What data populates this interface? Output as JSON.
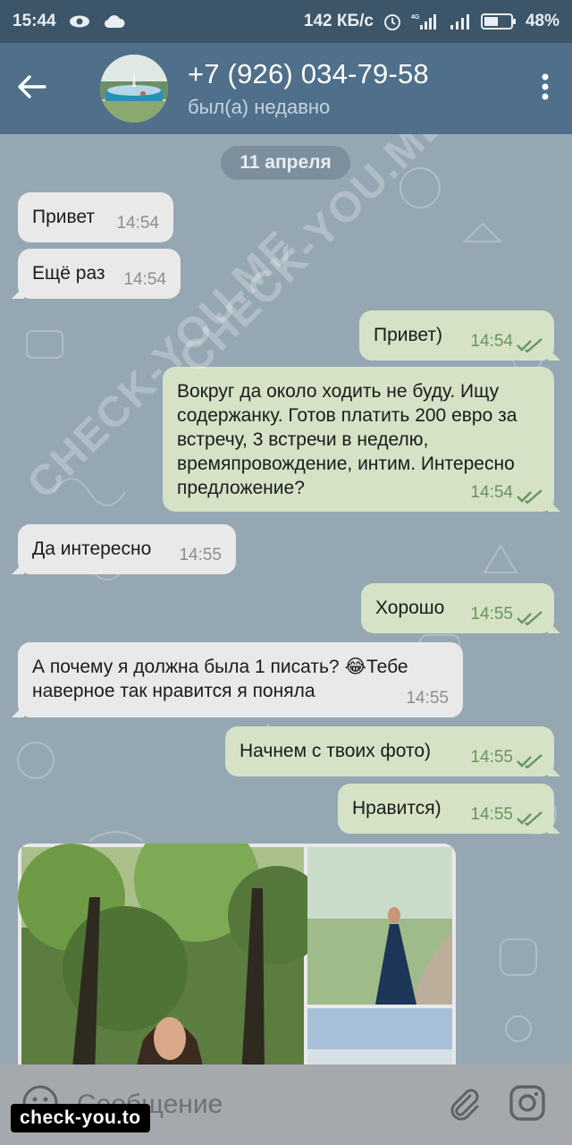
{
  "status_bar": {
    "time": "15:44",
    "net_speed": "142 КБ/с",
    "battery": "48%",
    "icons": [
      "eye-icon",
      "cloud-icon",
      "alarm-icon",
      "signal-icon",
      "signal-icon-2",
      "battery-icon"
    ]
  },
  "header": {
    "contact_name": "+7 (926) 034-79-58",
    "contact_status": "был(а) недавно",
    "back_icon": "arrow-left-icon",
    "menu_icon": "more-vertical-icon"
  },
  "chat": {
    "date_chip": "11 апреля",
    "messages": [
      {
        "dir": "in",
        "text": "Привет",
        "time": "14:54"
      },
      {
        "dir": "in",
        "text": "Ещё раз",
        "time": "14:54"
      },
      {
        "dir": "out",
        "text": "Привет)",
        "time": "14:54",
        "status": "read"
      },
      {
        "dir": "out",
        "text": "Вокруг да около ходить не буду. Ищу содержанку. Готов платить 200 евро за встречу, 3 встречи в неделю, времяпровождение, интим. Интересно предложение?",
        "time": "14:54",
        "status": "read"
      },
      {
        "dir": "in",
        "text": "Да интересно",
        "time": "14:55"
      },
      {
        "dir": "out",
        "text": "Хорошо",
        "time": "14:55",
        "status": "read"
      },
      {
        "dir": "in",
        "text": "А почему я должна была 1 писать? 😂Тебе наверное так нравится я поняла",
        "time": "14:55"
      },
      {
        "dir": "out",
        "text": "Начнем с твоих фото)",
        "time": "14:55",
        "status": "read"
      },
      {
        "dir": "out",
        "text": "Нравится)",
        "time": "14:55",
        "status": "read"
      }
    ],
    "photo_album": {
      "count_visible": 3
    }
  },
  "input_bar": {
    "placeholder": "Сообщение",
    "emoji_icon": "emoji-icon",
    "attach_icon": "paperclip-icon",
    "camera_icon": "instagram-camera-icon"
  },
  "watermarks": {
    "text": "CHECK-YOU.ME",
    "badge": "check-you.to"
  },
  "colors": {
    "header": "#4f6f8a",
    "statusbar": "#3c5569",
    "incoming_bubble": "#e9e9ea",
    "outgoing_bubble": "#d5e2c6",
    "read_ticks": "#69955f"
  }
}
